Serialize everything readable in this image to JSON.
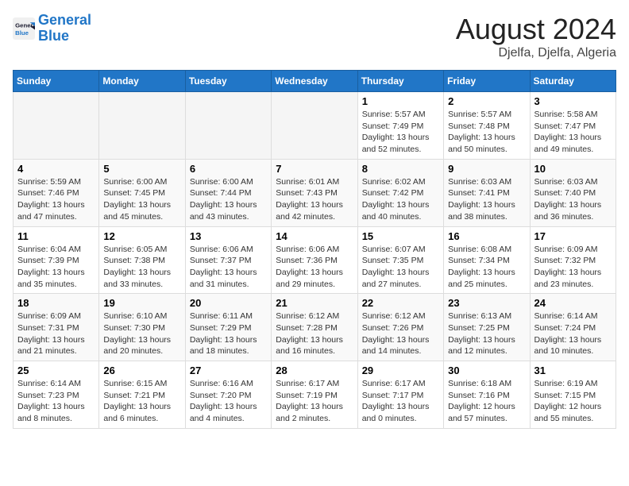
{
  "logo": {
    "line1": "General",
    "line2": "Blue"
  },
  "title": {
    "month_year": "August 2024",
    "location": "Djelfa, Djelfa, Algeria"
  },
  "header": {
    "days": [
      "Sunday",
      "Monday",
      "Tuesday",
      "Wednesday",
      "Thursday",
      "Friday",
      "Saturday"
    ]
  },
  "weeks": [
    {
      "days": [
        {
          "num": "",
          "info": ""
        },
        {
          "num": "",
          "info": ""
        },
        {
          "num": "",
          "info": ""
        },
        {
          "num": "",
          "info": ""
        },
        {
          "num": "1",
          "info": "Sunrise: 5:57 AM\nSunset: 7:49 PM\nDaylight: 13 hours\nand 52 minutes."
        },
        {
          "num": "2",
          "info": "Sunrise: 5:57 AM\nSunset: 7:48 PM\nDaylight: 13 hours\nand 50 minutes."
        },
        {
          "num": "3",
          "info": "Sunrise: 5:58 AM\nSunset: 7:47 PM\nDaylight: 13 hours\nand 49 minutes."
        }
      ]
    },
    {
      "days": [
        {
          "num": "4",
          "info": "Sunrise: 5:59 AM\nSunset: 7:46 PM\nDaylight: 13 hours\nand 47 minutes."
        },
        {
          "num": "5",
          "info": "Sunrise: 6:00 AM\nSunset: 7:45 PM\nDaylight: 13 hours\nand 45 minutes."
        },
        {
          "num": "6",
          "info": "Sunrise: 6:00 AM\nSunset: 7:44 PM\nDaylight: 13 hours\nand 43 minutes."
        },
        {
          "num": "7",
          "info": "Sunrise: 6:01 AM\nSunset: 7:43 PM\nDaylight: 13 hours\nand 42 minutes."
        },
        {
          "num": "8",
          "info": "Sunrise: 6:02 AM\nSunset: 7:42 PM\nDaylight: 13 hours\nand 40 minutes."
        },
        {
          "num": "9",
          "info": "Sunrise: 6:03 AM\nSunset: 7:41 PM\nDaylight: 13 hours\nand 38 minutes."
        },
        {
          "num": "10",
          "info": "Sunrise: 6:03 AM\nSunset: 7:40 PM\nDaylight: 13 hours\nand 36 minutes."
        }
      ]
    },
    {
      "days": [
        {
          "num": "11",
          "info": "Sunrise: 6:04 AM\nSunset: 7:39 PM\nDaylight: 13 hours\nand 35 minutes."
        },
        {
          "num": "12",
          "info": "Sunrise: 6:05 AM\nSunset: 7:38 PM\nDaylight: 13 hours\nand 33 minutes."
        },
        {
          "num": "13",
          "info": "Sunrise: 6:06 AM\nSunset: 7:37 PM\nDaylight: 13 hours\nand 31 minutes."
        },
        {
          "num": "14",
          "info": "Sunrise: 6:06 AM\nSunset: 7:36 PM\nDaylight: 13 hours\nand 29 minutes."
        },
        {
          "num": "15",
          "info": "Sunrise: 6:07 AM\nSunset: 7:35 PM\nDaylight: 13 hours\nand 27 minutes."
        },
        {
          "num": "16",
          "info": "Sunrise: 6:08 AM\nSunset: 7:34 PM\nDaylight: 13 hours\nand 25 minutes."
        },
        {
          "num": "17",
          "info": "Sunrise: 6:09 AM\nSunset: 7:32 PM\nDaylight: 13 hours\nand 23 minutes."
        }
      ]
    },
    {
      "days": [
        {
          "num": "18",
          "info": "Sunrise: 6:09 AM\nSunset: 7:31 PM\nDaylight: 13 hours\nand 21 minutes."
        },
        {
          "num": "19",
          "info": "Sunrise: 6:10 AM\nSunset: 7:30 PM\nDaylight: 13 hours\nand 20 minutes."
        },
        {
          "num": "20",
          "info": "Sunrise: 6:11 AM\nSunset: 7:29 PM\nDaylight: 13 hours\nand 18 minutes."
        },
        {
          "num": "21",
          "info": "Sunrise: 6:12 AM\nSunset: 7:28 PM\nDaylight: 13 hours\nand 16 minutes."
        },
        {
          "num": "22",
          "info": "Sunrise: 6:12 AM\nSunset: 7:26 PM\nDaylight: 13 hours\nand 14 minutes."
        },
        {
          "num": "23",
          "info": "Sunrise: 6:13 AM\nSunset: 7:25 PM\nDaylight: 13 hours\nand 12 minutes."
        },
        {
          "num": "24",
          "info": "Sunrise: 6:14 AM\nSunset: 7:24 PM\nDaylight: 13 hours\nand 10 minutes."
        }
      ]
    },
    {
      "days": [
        {
          "num": "25",
          "info": "Sunrise: 6:14 AM\nSunset: 7:23 PM\nDaylight: 13 hours\nand 8 minutes."
        },
        {
          "num": "26",
          "info": "Sunrise: 6:15 AM\nSunset: 7:21 PM\nDaylight: 13 hours\nand 6 minutes."
        },
        {
          "num": "27",
          "info": "Sunrise: 6:16 AM\nSunset: 7:20 PM\nDaylight: 13 hours\nand 4 minutes."
        },
        {
          "num": "28",
          "info": "Sunrise: 6:17 AM\nSunset: 7:19 PM\nDaylight: 13 hours\nand 2 minutes."
        },
        {
          "num": "29",
          "info": "Sunrise: 6:17 AM\nSunset: 7:17 PM\nDaylight: 13 hours\nand 0 minutes."
        },
        {
          "num": "30",
          "info": "Sunrise: 6:18 AM\nSunset: 7:16 PM\nDaylight: 12 hours\nand 57 minutes."
        },
        {
          "num": "31",
          "info": "Sunrise: 6:19 AM\nSunset: 7:15 PM\nDaylight: 12 hours\nand 55 minutes."
        }
      ]
    }
  ]
}
